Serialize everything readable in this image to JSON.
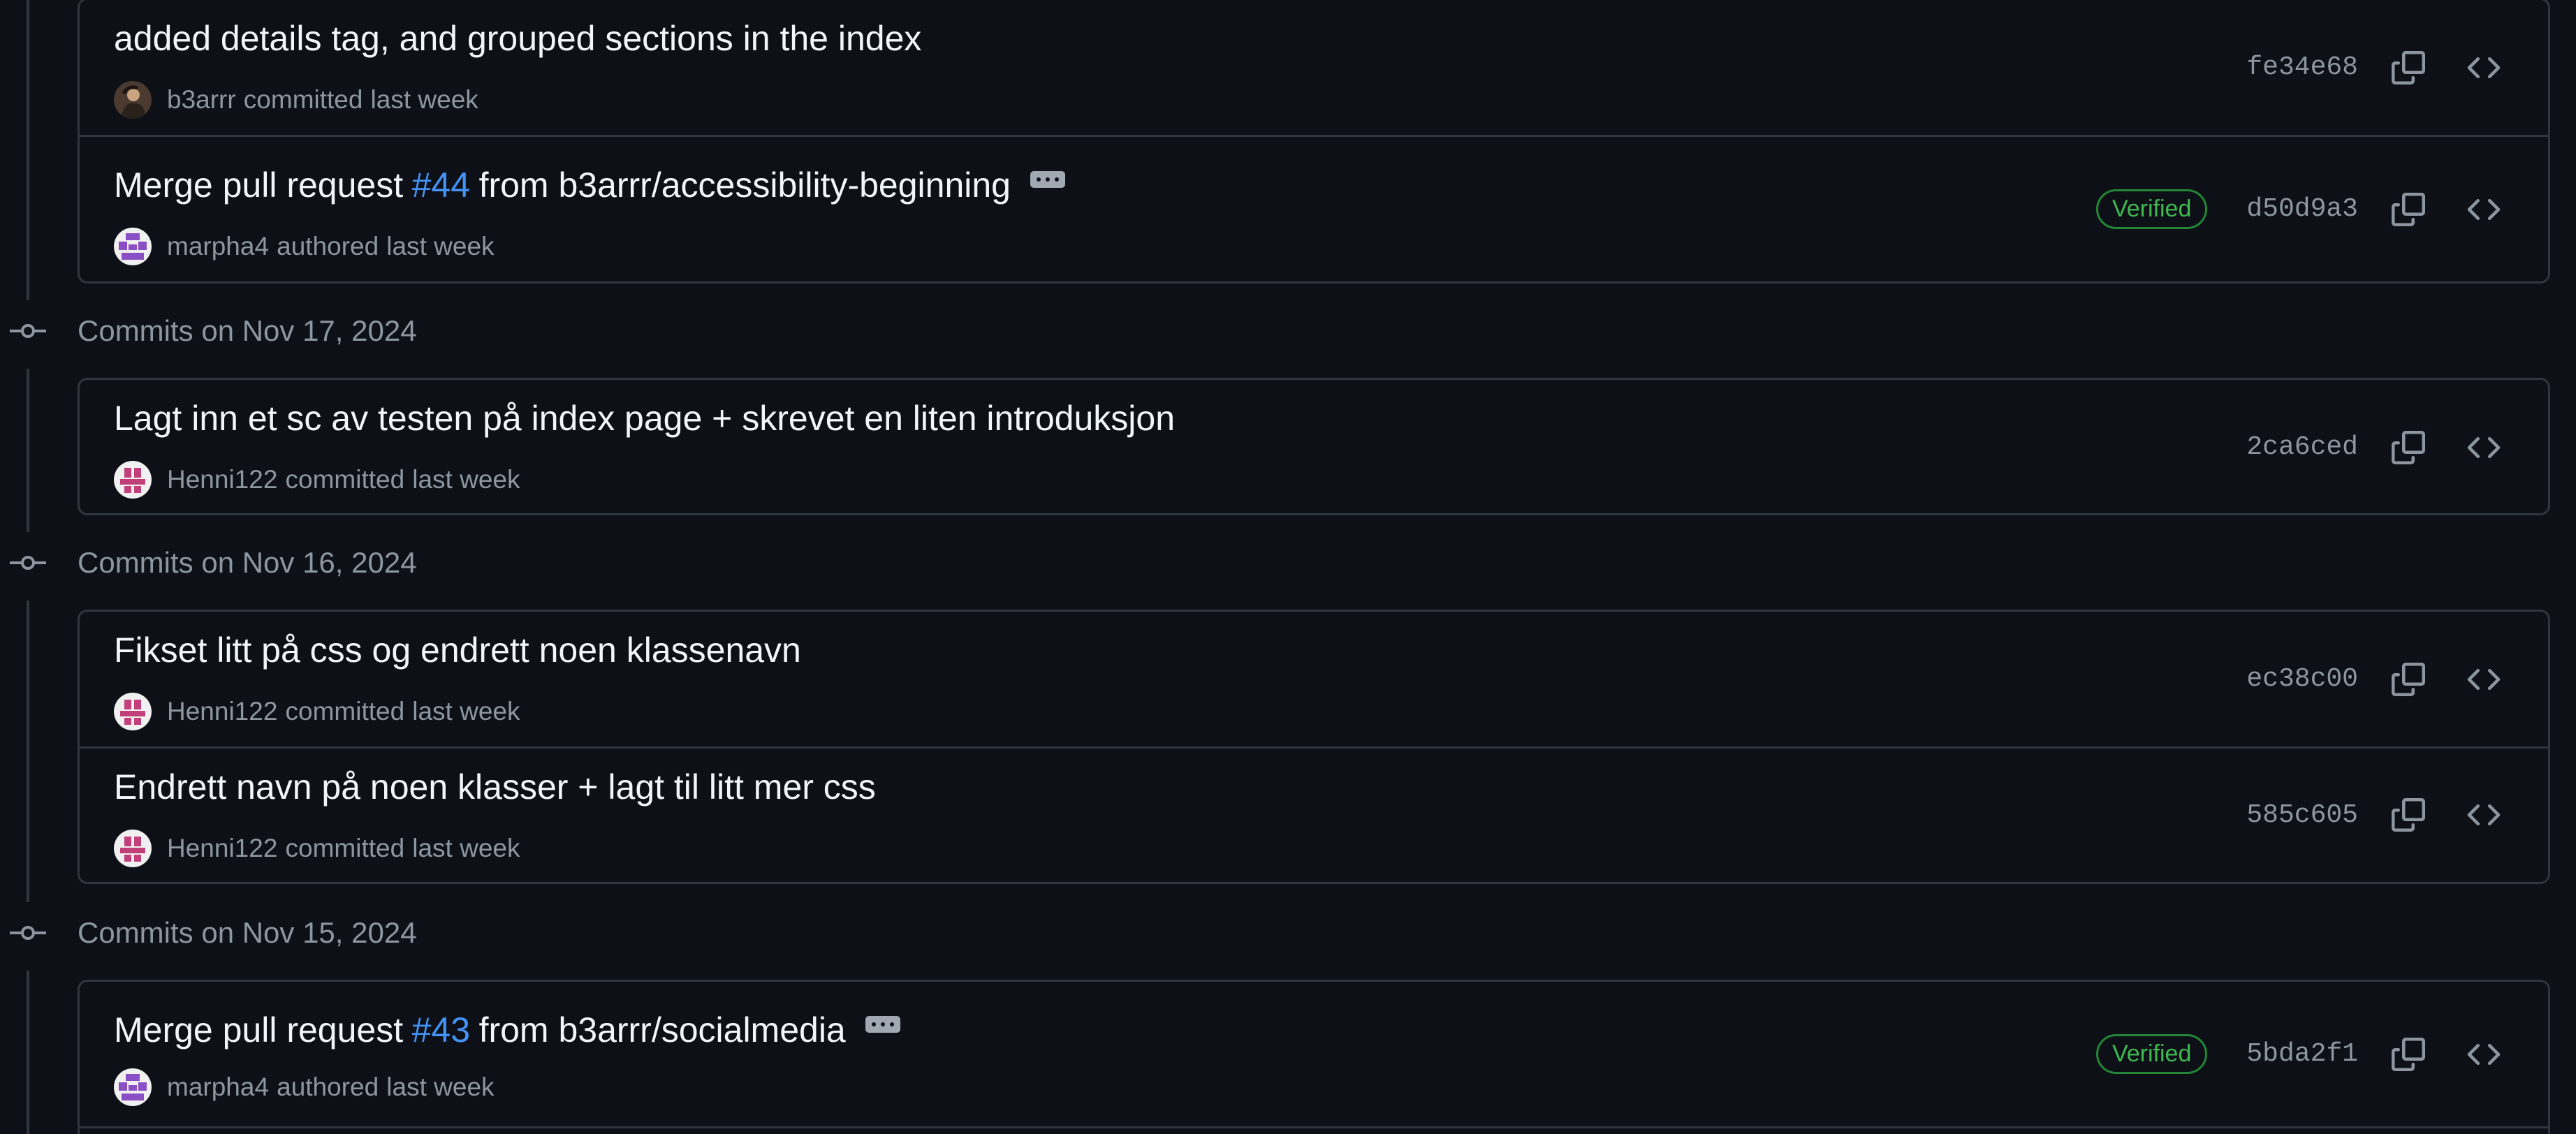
{
  "sections": [
    {
      "date_label": "",
      "commits": [
        {
          "title_pre": "added details tag, and grouped sections in the index",
          "pr_number": "",
          "title_post": "",
          "has_ellipsis": false,
          "author": "b3arrr",
          "action": "committed",
          "time": "last week",
          "avatar_icon": "photo-avatar",
          "verified": "",
          "sha": "fe34e68"
        },
        {
          "title_pre": "Merge pull request",
          "pr_number": "#44",
          "title_post": "from b3arrr/accessibility-beginning",
          "has_ellipsis": true,
          "author": "marpha4",
          "action": "authored",
          "time": "last week",
          "avatar_icon": "identicon-purple",
          "verified": "Verified",
          "sha": "d50d9a3"
        }
      ]
    },
    {
      "date_label": "Commits on Nov 17, 2024",
      "commits": [
        {
          "title_pre": "Lagt inn et sc av testen på index page + skrevet en liten introduksjon",
          "pr_number": "",
          "title_post": "",
          "has_ellipsis": false,
          "author": "Henni122",
          "action": "committed",
          "time": "last week",
          "avatar_icon": "identicon-pink",
          "verified": "",
          "sha": "2ca6ced"
        }
      ]
    },
    {
      "date_label": "Commits on Nov 16, 2024",
      "commits": [
        {
          "title_pre": "Fikset litt på css og endrett noen klassenavn",
          "pr_number": "",
          "title_post": "",
          "has_ellipsis": false,
          "author": "Henni122",
          "action": "committed",
          "time": "last week",
          "avatar_icon": "identicon-pink",
          "verified": "",
          "sha": "ec38c00"
        },
        {
          "title_pre": "Endrett navn på noen klasser + lagt til litt mer css",
          "pr_number": "",
          "title_post": "",
          "has_ellipsis": false,
          "author": "Henni122",
          "action": "committed",
          "time": "last week",
          "avatar_icon": "identicon-pink",
          "verified": "",
          "sha": "585c605"
        }
      ]
    },
    {
      "date_label": "Commits on Nov 15, 2024",
      "commits": [
        {
          "title_pre": "Merge pull request",
          "pr_number": "#43",
          "title_post": "from b3arrr/socialmedia",
          "has_ellipsis": true,
          "author": "marpha4",
          "action": "authored",
          "time": "last week",
          "avatar_icon": "identicon-purple",
          "verified": "Verified",
          "sha": "5bda2f1"
        }
      ]
    }
  ],
  "icons": {
    "copy": "copy-icon",
    "browse": "code-icon",
    "timeline": "git-commit-icon"
  },
  "colors": {
    "background": "#0d1117",
    "border": "#30363d",
    "link": "#4493f8",
    "verified": "#3fb950",
    "muted": "#8d96a0"
  }
}
